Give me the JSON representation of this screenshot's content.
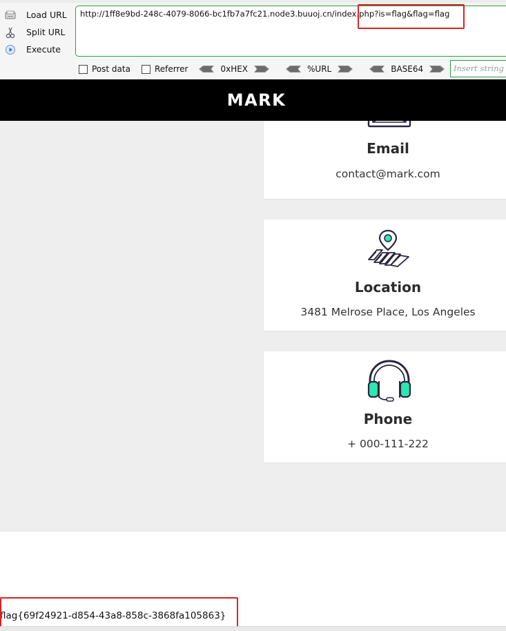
{
  "hackbar": {
    "actions": [
      {
        "label": "Load URL",
        "icon": "load-url-icon"
      },
      {
        "label": "Split URL",
        "icon": "split-url-icon"
      },
      {
        "label": "Execute",
        "icon": "execute-icon"
      }
    ],
    "url": "http://1ff8e9bd-248c-4079-8066-bc1fb7a7fc21.node3.buuoj.cn/index.php?is=flag&flag=flag",
    "options": {
      "post_data": "Post data",
      "referrer": "Referrer"
    },
    "encoders": [
      "0xHEX",
      "%URL",
      "BASE64"
    ],
    "insert_placeholder": "Insert string to replace",
    "accent_color": "#2e9e3d"
  },
  "site": {
    "logo": "MARK"
  },
  "contact_cards": [
    {
      "title": "Email",
      "detail": "contact@mark.com",
      "icon": "envelope-icon"
    },
    {
      "title": "Location",
      "detail": "3481 Melrose Place, Los Angeles",
      "icon": "map-pin-icon"
    },
    {
      "title": "Phone",
      "detail": "+ 000-111-222",
      "icon": "headset-icon"
    }
  ],
  "output": {
    "flag": "flag{69f24921-d854-43a8-858c-3868fa105863}"
  },
  "colors": {
    "header_bg": "#000000",
    "content_bg": "#eeeeee",
    "icon_teal": "#2ee6b0",
    "icon_outline": "#2a2440",
    "highlight_red": "#e02020"
  }
}
